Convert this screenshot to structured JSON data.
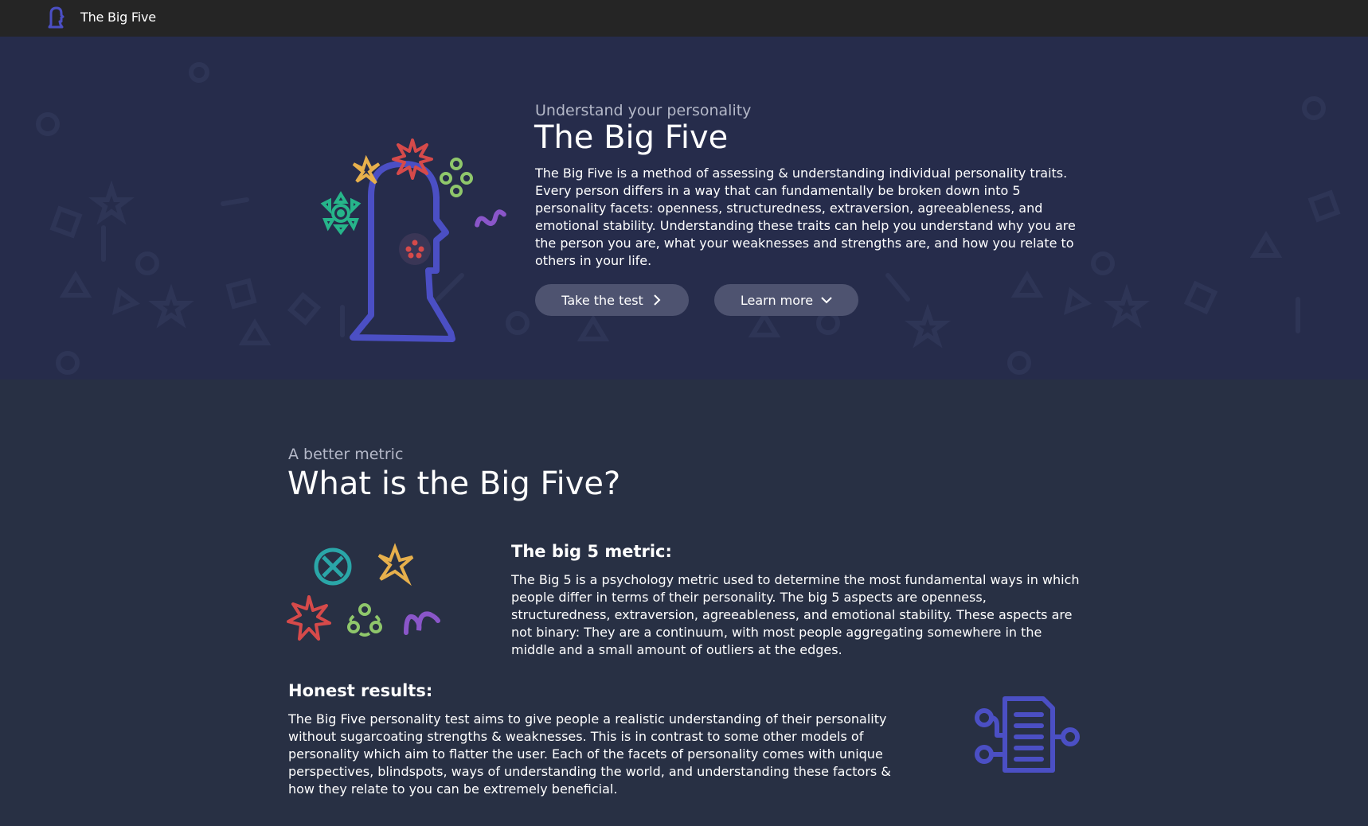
{
  "header": {
    "brand": "The Big Five",
    "logo_icon": "head-silhouette-icon"
  },
  "hero": {
    "subtitle": "Understand your personality",
    "title": "The Big Five",
    "description": "The Big Five is a method of assessing & understanding individual personality traits. Every person differs in a way that can fundamentally be broken down into 5 personality facets: openness, structuredness, extraversion, agreeableness, and emotional stability. Understanding these traits can help you understand why you are the person you are, what your weaknesses and strengths are, and how you relate to others in your life.",
    "buttons": {
      "take_test": "Take the test",
      "learn_more": "Learn more"
    }
  },
  "section": {
    "subtitle": "A better metric",
    "title": "What is the Big Five?",
    "metric": {
      "heading": "The big 5 metric:",
      "text": "The Big 5 is a psychology metric used to determine the most fundamental ways in which people differ in terms of their personality. The big 5 aspects are openness, structuredness, extraversion, agreeableness, and emotional stability. These aspects are not binary: They are a continuum, with most people aggregating somewhere in the middle and a small amount of outliers at the edges."
    },
    "honest": {
      "heading": "Honest results:",
      "text": "The Big Five personality test aims to give people a realistic understanding of their personality without sugarcoating strengths & weaknesses. This is in contrast to some other models of personality which aim to flatter the user. Each of the facets of personality comes with unique perspectives, blindspots, ways of understanding the world, and understanding these factors & how they relate to you can be extremely beneficial."
    }
  },
  "colors": {
    "topbar": "#252525",
    "hero_bg": "#262c4b",
    "page_bg": "#283044",
    "button_bg": "#4e5370",
    "accent_indigo": "#4b4fc4",
    "trait_red": "#d64a4a",
    "trait_yellow": "#e7b04c",
    "trait_green": "#8fc76b",
    "trait_teal": "#2aa6a8",
    "trait_purple": "#8a56c9"
  },
  "icons": [
    "head-silhouette-icon",
    "star-burst-icon",
    "pinwheel-icon",
    "circles-ring-icon",
    "squiggle-icon",
    "triangle-gear-icon",
    "wheel-icon",
    "document-network-icon",
    "chevron-right-icon",
    "chevron-down-icon"
  ]
}
